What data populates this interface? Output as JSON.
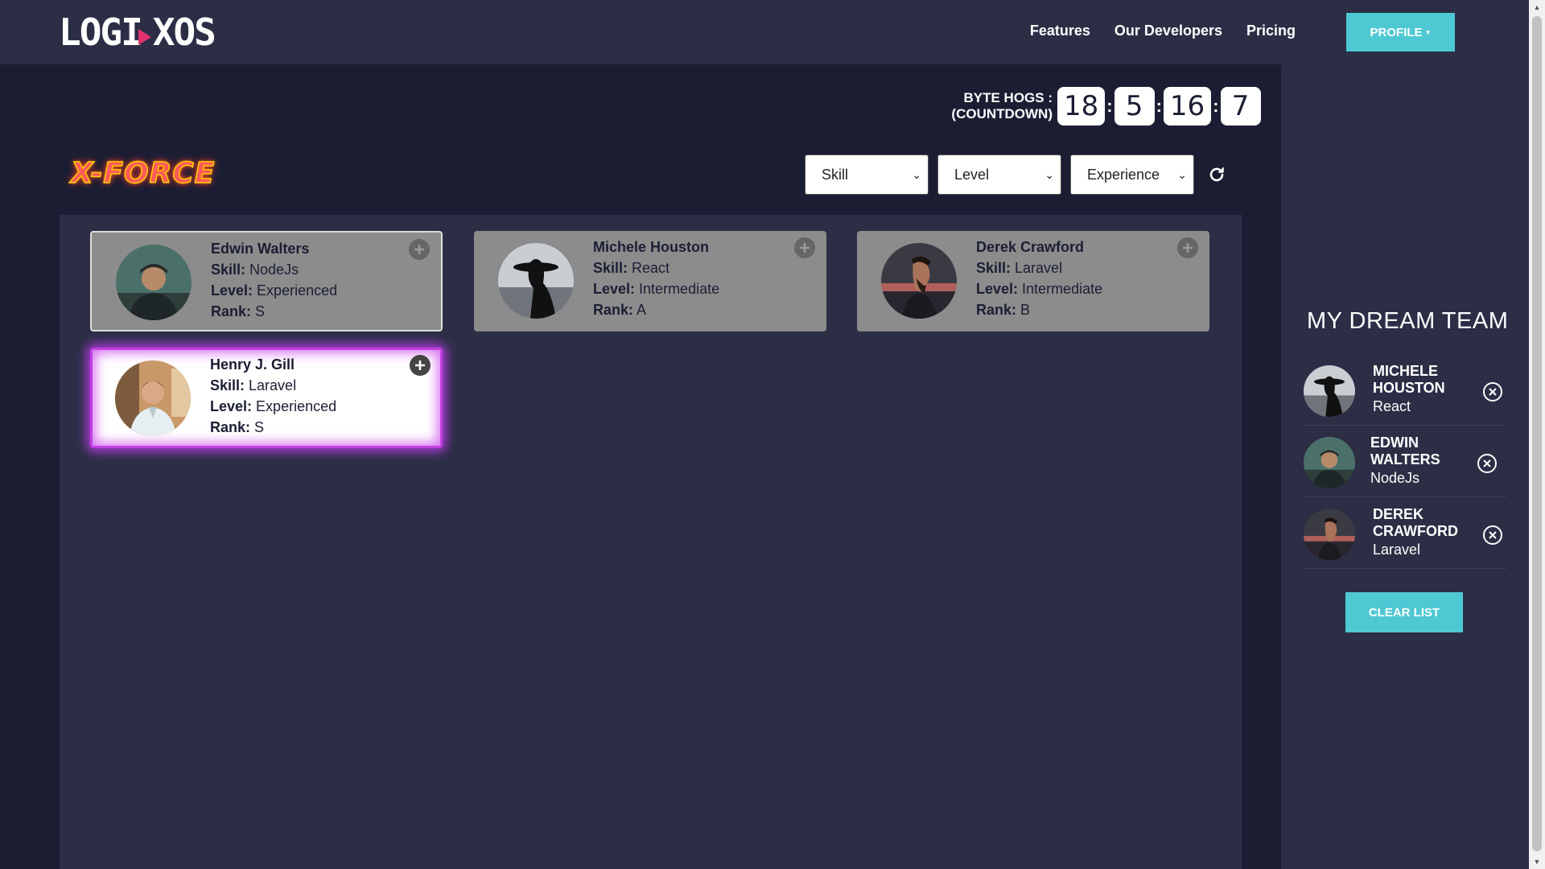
{
  "header": {
    "logo_text": "LOGI OS",
    "nav": [
      "Features",
      "Our Developers",
      "Pricing"
    ],
    "profile_label": "PROFILE"
  },
  "countdown": {
    "label_line1": "BYTE HOGS :",
    "label_line2": "(COUNTDOWN)",
    "values": [
      "18",
      "5",
      "16",
      "7"
    ],
    "separator": ":"
  },
  "title": "X-FORCE",
  "filters": {
    "skill": "Skill",
    "level": "Level",
    "experience": "Experience"
  },
  "labels": {
    "skill": "Skill:",
    "level": "Level:",
    "rank": "Rank:"
  },
  "developers": [
    {
      "name": "Edwin Walters",
      "skill": "NodeJs",
      "level": "Experienced",
      "rank": "S"
    },
    {
      "name": "Michele Houston",
      "skill": "React",
      "level": "Intermediate",
      "rank": "A"
    },
    {
      "name": "Derek Crawford",
      "skill": "Laravel",
      "level": "Intermediate",
      "rank": "B"
    },
    {
      "name": "Henry J. Gill",
      "skill": "Laravel",
      "level": "Experienced",
      "rank": "S"
    }
  ],
  "dream_team": {
    "title": "MY DREAM TEAM",
    "members": [
      {
        "name_line1": "MICHELE",
        "name_line2": "HOUSTON",
        "skill": "React"
      },
      {
        "name_line1": "EDWIN",
        "name_line2": "WALTERS",
        "skill": "NodeJs"
      },
      {
        "name_line1": "DEREK",
        "name_line2": "CRAWFORD",
        "skill": "Laravel"
      }
    ],
    "clear_label": "CLEAR LIST"
  },
  "colors": {
    "background": "#1b1e33",
    "panel": "#2b2e45",
    "accent": "#4ec8d3",
    "highlight": "#c23fe0",
    "logo_accent": "#e3316e"
  }
}
